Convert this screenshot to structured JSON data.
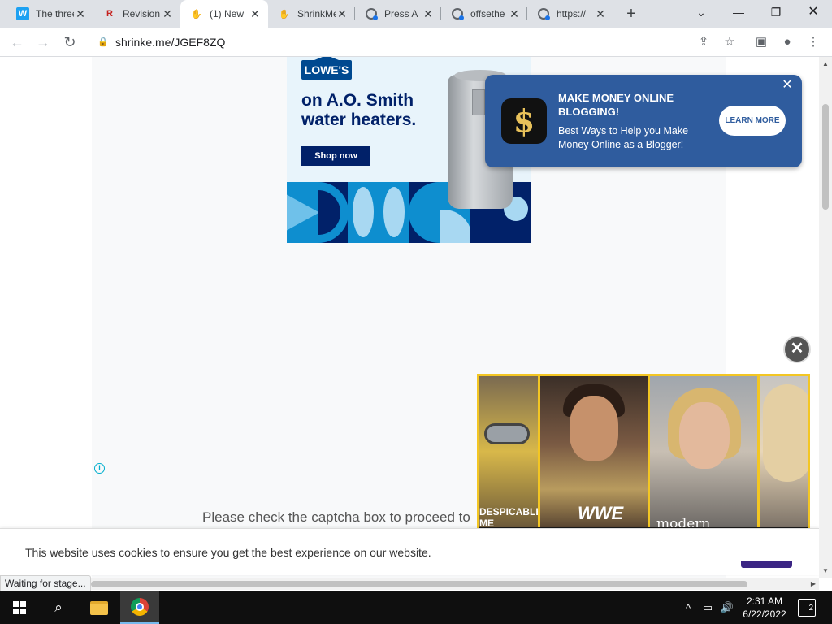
{
  "browser": {
    "tabs": [
      {
        "title": "The three",
        "icon": "w-icon"
      },
      {
        "title": "Revision",
        "icon": "r-icon"
      },
      {
        "title": "(1) New",
        "icon": "hand-icon"
      },
      {
        "title": "ShrinkMe",
        "icon": "hand-icon"
      },
      {
        "title": "Press A",
        "icon": "globe-icon"
      },
      {
        "title": "offsethe",
        "icon": "globe-icon"
      },
      {
        "title": "https://",
        "icon": "globe-icon"
      }
    ],
    "active_tab": 2,
    "url": "shrinke.me/JGEF8ZQ",
    "status": "Waiting for stage..."
  },
  "ads": {
    "lowes": {
      "brand": "LOWE'S",
      "headline": "on A.O. Smith water heaters.",
      "cta": "Shop now"
    },
    "blogging": {
      "title": "MAKE MONEY ONLINE BLOGGING!",
      "body": "Best Ways to Help you Make Money Online as a Blogger!",
      "button": "LEARN MORE",
      "icon_glyph": "$"
    },
    "video": {
      "logos": [
        "WWE",
        "modern family"
      ],
      "ticker": "DESPICABLE ME"
    }
  },
  "page": {
    "captcha_text": "Please check the captcha box to proceed to",
    "cookie_text": "This website uses cookies to ensure you get the best experience on our website."
  },
  "taskbar": {
    "time": "2:31 AM",
    "date": "6/22/2022",
    "notification_count": "2"
  },
  "colors": {
    "lowes_blue": "#012169",
    "notif_blue": "#2f5c9e",
    "video_border": "#f3c623"
  }
}
